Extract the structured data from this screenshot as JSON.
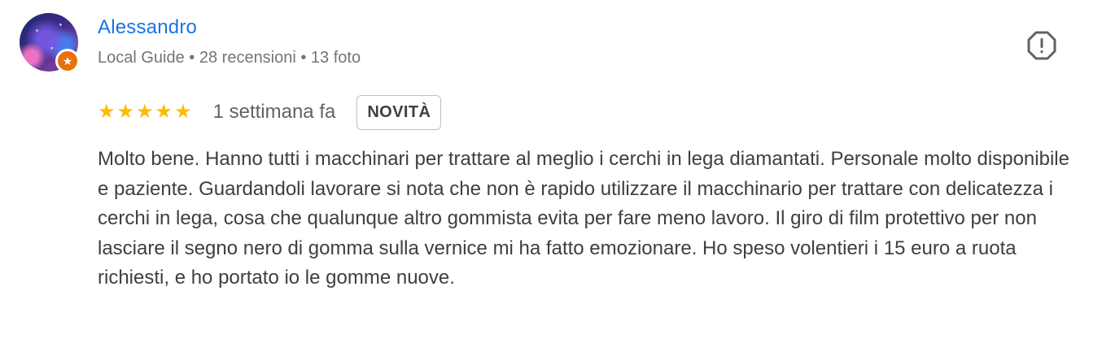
{
  "reviewer": {
    "name": "Alessandro",
    "meta": "Local Guide • 28 recensioni • 13 foto",
    "avatar_icon": "galaxy-avatar",
    "badge_icon": "local-guide-star-icon"
  },
  "rating": {
    "stars": 5,
    "time": "1 settimana fa",
    "tag": "NOVITÀ",
    "star_color": "#fbbc04"
  },
  "report_icon": "report-icon",
  "review_text": "Molto bene. Hanno tutti i macchinari per trattare al meglio i cerchi in lega diamantati. Personale molto disponibile e paziente. Guardandoli lavorare si nota che non è rapido utilizzare il macchinario per trattare con delicatezza i cerchi in lega, cosa che qualunque altro gommista evita per fare meno lavoro. Il giro di film protettivo per non lasciare il segno nero di gomma sulla vernice mi ha fatto emozionare. Ho speso volentieri i 15 euro a ruota richiesti, e ho portato io le gomme nuove.",
  "colors": {
    "name": "#1a73e8",
    "badge": "#e8710a",
    "text": "#3c4043",
    "meta": "#70757a"
  }
}
